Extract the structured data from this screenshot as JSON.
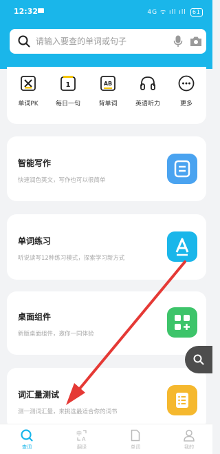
{
  "status": {
    "time": "12:32",
    "signal": "4G ᯤ ıll ıll",
    "battery": "61"
  },
  "search": {
    "placeholder": "请输入要查的单词或句子",
    "icon": "search-icon",
    "mic_icon": "microphone-icon",
    "camera_icon": "camera-icon"
  },
  "tools": [
    {
      "label": "单词PK",
      "icon": "pk-icon"
    },
    {
      "label": "每日一句",
      "icon": "calendar-icon"
    },
    {
      "label": "背单词",
      "icon": "flashcard-icon"
    },
    {
      "label": "英语听力",
      "icon": "headphones-icon"
    },
    {
      "label": "更多",
      "icon": "more-icon"
    }
  ],
  "cards": [
    {
      "title": "智能写作",
      "subtitle": "快速润色英文，写作也可以很简单",
      "icon": "document-icon",
      "color": "#4aa3f0"
    },
    {
      "title": "单词练习",
      "subtitle": "听说读写12种练习模式，探索学习新方式",
      "icon": "letter-a-icon",
      "color": "#1ab6ea"
    },
    {
      "title": "桌面组件",
      "subtitle": "新版桌面组件，邀你一同体验",
      "icon": "widgets-icon",
      "color": "#3dc46a"
    },
    {
      "title": "词汇量测试",
      "subtitle": "测一测词汇量，来挑选最适合你的词书",
      "icon": "list-icon",
      "color": "#f5b82e"
    }
  ],
  "tabs": [
    {
      "label": "查词",
      "active": true
    },
    {
      "label": "翻译",
      "active": false
    },
    {
      "label": "单词",
      "active": false
    },
    {
      "label": "我的",
      "active": false
    }
  ],
  "colors": {
    "primary": "#1ab6ea",
    "arrow": "#e53935"
  }
}
